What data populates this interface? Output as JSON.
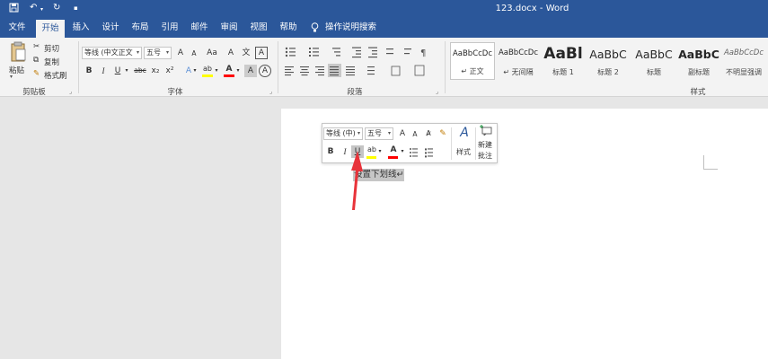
{
  "titlebar": {
    "title": "123.docx  -  Word",
    "save_icon": "save-icon",
    "undo_icon": "undo-icon",
    "redo_icon": "redo-icon",
    "customize_icon": "customize-quick-access-icon"
  },
  "tabs": [
    {
      "label": "文件"
    },
    {
      "label": "开始"
    },
    {
      "label": "插入"
    },
    {
      "label": "设计"
    },
    {
      "label": "布局"
    },
    {
      "label": "引用"
    },
    {
      "label": "邮件"
    },
    {
      "label": "审阅"
    },
    {
      "label": "视图"
    },
    {
      "label": "帮助"
    }
  ],
  "tell_me": "操作说明搜索",
  "clipboard": {
    "paste": "粘贴",
    "cut": "剪切",
    "copy": "复制",
    "format_painter": "格式刷",
    "group": "剪贴板"
  },
  "font": {
    "font_name": "等线 (中文正文",
    "font_size": "五号",
    "grow": "A",
    "shrink": "A",
    "case": "Aa",
    "clear": "A",
    "phonetic": "文",
    "border": "A",
    "bold": "B",
    "italic": "I",
    "underline": "U",
    "strike": "abc",
    "sub": "x₂",
    "sup": "x²",
    "effects": "A",
    "highlight": "ab",
    "color": "A",
    "char_shade": "A",
    "char_border": "A",
    "group": "字体"
  },
  "paragraph": {
    "group": "段落"
  },
  "styles": {
    "group": "样式",
    "items": [
      {
        "sample": "AaBbCcDc",
        "name": "↵ 正文"
      },
      {
        "sample": "AaBbCcDc",
        "name": "↵ 无间隔"
      },
      {
        "sample": "AaBl",
        "name": "标题 1"
      },
      {
        "sample": "AaBbC",
        "name": "标题 2"
      },
      {
        "sample": "AaBbC",
        "name": "标题"
      },
      {
        "sample": "AaBbC",
        "name": "副标题"
      },
      {
        "sample": "AaBbCcDc",
        "name": "不明显强调"
      }
    ]
  },
  "mini_toolbar": {
    "font_name": "等线 (中)",
    "font_size": "五号",
    "grow": "A",
    "shrink": "A",
    "styles_label": "样式",
    "new_comment": "新建",
    "new_comment2": "批注",
    "bold": "B",
    "italic": "I",
    "underline": "U",
    "highlight": "ab",
    "color": "A"
  },
  "document": {
    "selected_text": "设置下划线↵"
  },
  "colors": {
    "brand": "#2b579a",
    "highlight_bar": "#ffff00",
    "font_color_bar": "#ff0000",
    "arrow": "#e8333a"
  }
}
